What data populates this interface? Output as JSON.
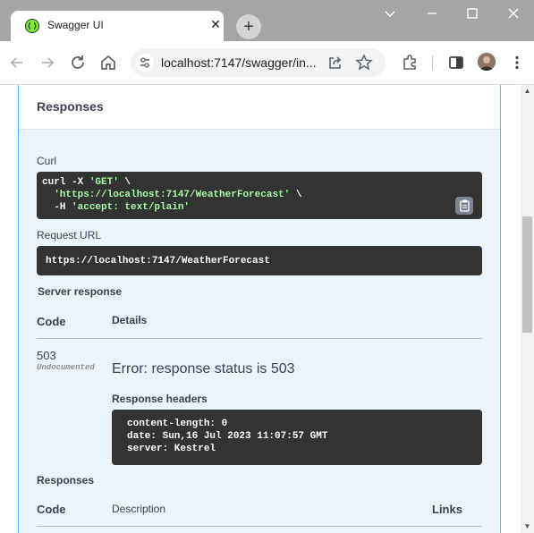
{
  "browser": {
    "tab_title": "Swagger UI",
    "tab_close": "✕",
    "new_tab": "+",
    "url": "localhost:7147/swagger/in..."
  },
  "responses_header": "Responses",
  "curl": {
    "label": "Curl",
    "line1_a": "curl -X ",
    "line1_b": "'GET'",
    "line1_c": " \\",
    "line2_a": "  ",
    "line2_b": "'https://localhost:7147/WeatherForecast'",
    "line2_c": " \\",
    "line3_a": "  -H ",
    "line3_b": "'accept: text/plain'"
  },
  "request_url": {
    "label": "Request URL",
    "value": "https://localhost:7147/WeatherForecast"
  },
  "server_response": {
    "label": "Server response",
    "col_code": "Code",
    "col_details": "Details",
    "code": "503",
    "undocumented": "Undocumented",
    "error": "Error: response status is 503",
    "headers_label": "Response headers",
    "headers": [
      "content-length: 0",
      "date: Sun,16 Jul 2023 11:07:57 GMT",
      "server: Kestrel"
    ]
  },
  "responses_table": {
    "label": "Responses",
    "col_code": "Code",
    "col_description": "Description",
    "col_links": "Links"
  }
}
